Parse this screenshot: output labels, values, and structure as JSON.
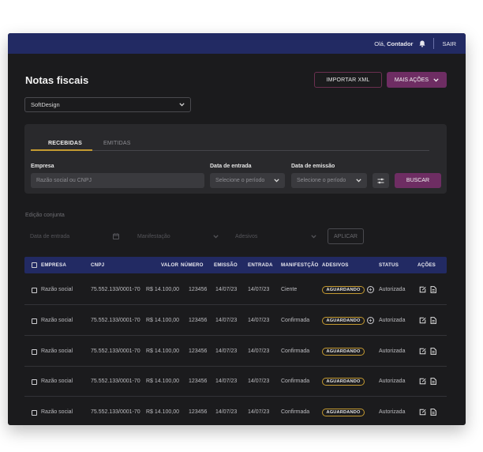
{
  "topbar": {
    "greeting": "Olá, ",
    "user": "Contador",
    "logout": "SAIR"
  },
  "page": {
    "title": "Notas fiscais"
  },
  "actions": {
    "import_xml": "IMPORTAR XML",
    "more": "MAIS AÇÕES"
  },
  "company_select": {
    "value": "SoftDesign"
  },
  "tabs": {
    "received": "RECEBIDAS",
    "issued": "EMITIDAS"
  },
  "filters": {
    "company_label": "Empresa",
    "company_placeholder": "Razão social ou CNPJ",
    "entry_date_label": "Data de entrada",
    "entry_date_placeholder": "Selecione o período",
    "issue_date_label": "Data de emissão",
    "issue_date_placeholder": "Selecione o período",
    "search": "BUSCAR"
  },
  "bulk": {
    "title": "Edição conjunta",
    "entry_date": "Data de entrada",
    "manifest": "Manifestação",
    "stickers": "Adesivos",
    "apply": "APLICAR"
  },
  "table": {
    "headers": {
      "company": "EMPRESA",
      "cnpj": "CNPJ",
      "value": "VALOR",
      "number": "NÚMERO",
      "issue": "EMISSÃO",
      "entry": "ENTRADA",
      "manifest": "MANIFESTÇÃO",
      "stickers": "ADESIVOS",
      "status": "STATUS",
      "actions": "AÇÕES"
    },
    "rows": [
      {
        "company": "Razão social",
        "cnpj": "75.552.133/0001-70",
        "value": "R$ 14.100,00",
        "number": "123456",
        "issue": "14/07/23",
        "entry": "14/07/23",
        "manifest": "Ciente",
        "sticker": "AGUARDANDO",
        "status": "Autorizada"
      },
      {
        "company": "Razão social",
        "cnpj": "75.552.133/0001-70",
        "value": "R$ 14.100,00",
        "number": "123456",
        "issue": "14/07/23",
        "entry": "14/07/23",
        "manifest": "Confirmada",
        "sticker": "AGUARDANDO",
        "status": "Autorizada"
      },
      {
        "company": "Razão social",
        "cnpj": "75.552.133/0001-70",
        "value": "R$ 14.100,00",
        "number": "123456",
        "issue": "14/07/23",
        "entry": "14/07/23",
        "manifest": "Confirmada",
        "sticker": "AGUARDANDO",
        "status": "Autorizada"
      },
      {
        "company": "Razão social",
        "cnpj": "75.552.133/0001-70",
        "value": "R$ 14.100,00",
        "number": "123456",
        "issue": "14/07/23",
        "entry": "14/07/23",
        "manifest": "Confirmada",
        "sticker": "AGUARDANDO",
        "status": "Autorizada"
      },
      {
        "company": "Razão social",
        "cnpj": "75.552.133/0001-70",
        "value": "R$ 14.100,00",
        "number": "123456",
        "issue": "14/07/23",
        "entry": "14/07/23",
        "manifest": "Confirmada",
        "sticker": "AGUARDANDO",
        "status": "Autorizada"
      }
    ]
  },
  "colors": {
    "brand_navy": "#222a63",
    "accent_purple": "#6e2d63",
    "accent_gold": "#c49a31",
    "background": "#1b1b1d"
  },
  "icons": [
    "bell-icon",
    "chevron-down-icon",
    "sliders-icon",
    "calendar-icon",
    "checkbox-icon",
    "add-circle-icon",
    "edit-icon",
    "document-icon"
  ]
}
